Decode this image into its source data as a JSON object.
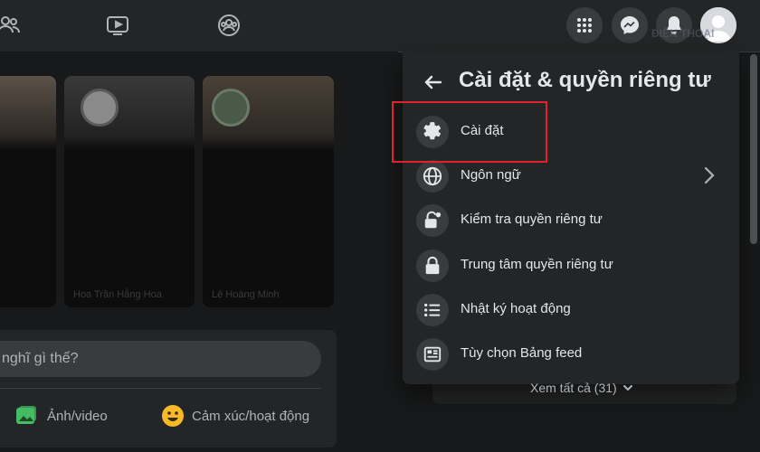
{
  "settings_panel": {
    "title": "Cài đặt & quyền riêng tư",
    "items": [
      {
        "label": "Cài đặt",
        "icon": "gear-icon"
      },
      {
        "label": "Ngôn ngữ",
        "icon": "globe-icon",
        "has_submenu": true
      },
      {
        "label": "Kiểm tra quyền riêng tư",
        "icon": "lock-check-icon"
      },
      {
        "label": "Trung tâm quyền riêng tư",
        "icon": "lock-icon"
      },
      {
        "label": "Nhật ký hoạt động",
        "icon": "list-icon"
      },
      {
        "label": "Tùy chọn Bảng feed",
        "icon": "feed-icon"
      }
    ],
    "see_all": "Xem tất cả (31)"
  },
  "composer": {
    "placeholder": "nghĩ gì thế?",
    "actions": [
      {
        "label": "Ảnh/video",
        "icon": "photo-icon"
      },
      {
        "label": "Cảm xúc/hoạt động",
        "icon": "smiley-icon"
      }
    ]
  },
  "colors": {
    "background": "#18191a",
    "surface": "#242526",
    "button": "#3a3b3c",
    "text": "#e4e6eb",
    "secondary_text": "#b0b3b8",
    "highlight_border": "#e0222d",
    "photo_green": "#45bd62",
    "smiley_yellow": "#f7b928"
  }
}
